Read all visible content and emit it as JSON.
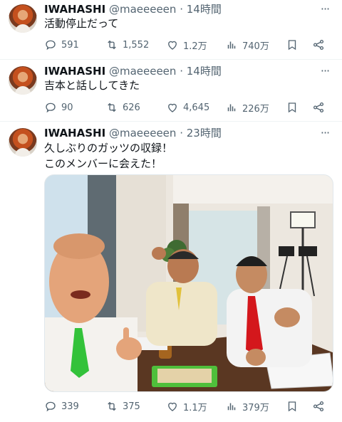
{
  "tweets": [
    {
      "name": "IWAHASHI",
      "handle": "@maeeeeen",
      "dot": "·",
      "time": "14時間",
      "text": "活動停止だって",
      "replies": "591",
      "retweets": "1,552",
      "likes": "1.2万",
      "views": "740万"
    },
    {
      "name": "IWAHASHI",
      "handle": "@maeeeeen",
      "dot": "·",
      "time": "14時間",
      "text": "吉本と話ししてきた",
      "replies": "90",
      "retweets": "626",
      "likes": "4,645",
      "views": "226万"
    },
    {
      "name": "IWAHASHI",
      "handle": "@maeeeeen",
      "dot": "·",
      "time": "23時間",
      "text": "久しぶりのガッツの収録！\nこのメンバーに会えた！",
      "replies": "339",
      "retweets": "375",
      "likes": "1.1万",
      "views": "379万"
    }
  ],
  "icons": {
    "more": "more-icon",
    "reply": "reply-icon",
    "retweet": "retweet-icon",
    "like": "heart-icon",
    "views": "views-icon",
    "bookmark": "bookmark-icon",
    "share": "share-icon"
  },
  "colors": {
    "text_primary": "#0f1419",
    "text_secondary": "#536471",
    "divider": "#eff3f4",
    "tie_green": "#33c23a",
    "tie_red": "#d4171c"
  }
}
